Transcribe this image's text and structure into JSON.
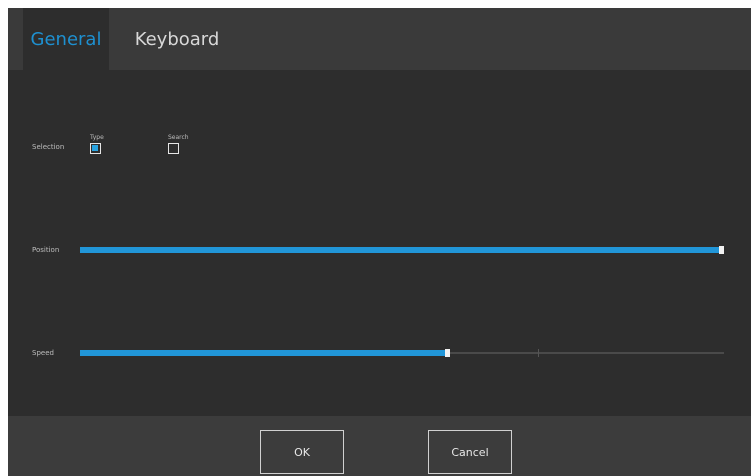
{
  "tabs": {
    "general": "General",
    "keyboard": "Keyboard"
  },
  "general": {
    "selection": {
      "label": "Selection",
      "options": [
        {
          "label": "Type",
          "checked": true
        },
        {
          "label": "Search",
          "checked": false
        }
      ]
    },
    "position": {
      "label": "Position",
      "value_fraction": 1.0
    },
    "speed": {
      "label": "Speed",
      "value_fraction": 0.57
    }
  },
  "buttons": {
    "ok": "OK",
    "cancel": "Cancel"
  },
  "colors": {
    "accent": "#2196d8",
    "active_tab_text": "#1e90d0",
    "background": "#2d2d2d"
  }
}
